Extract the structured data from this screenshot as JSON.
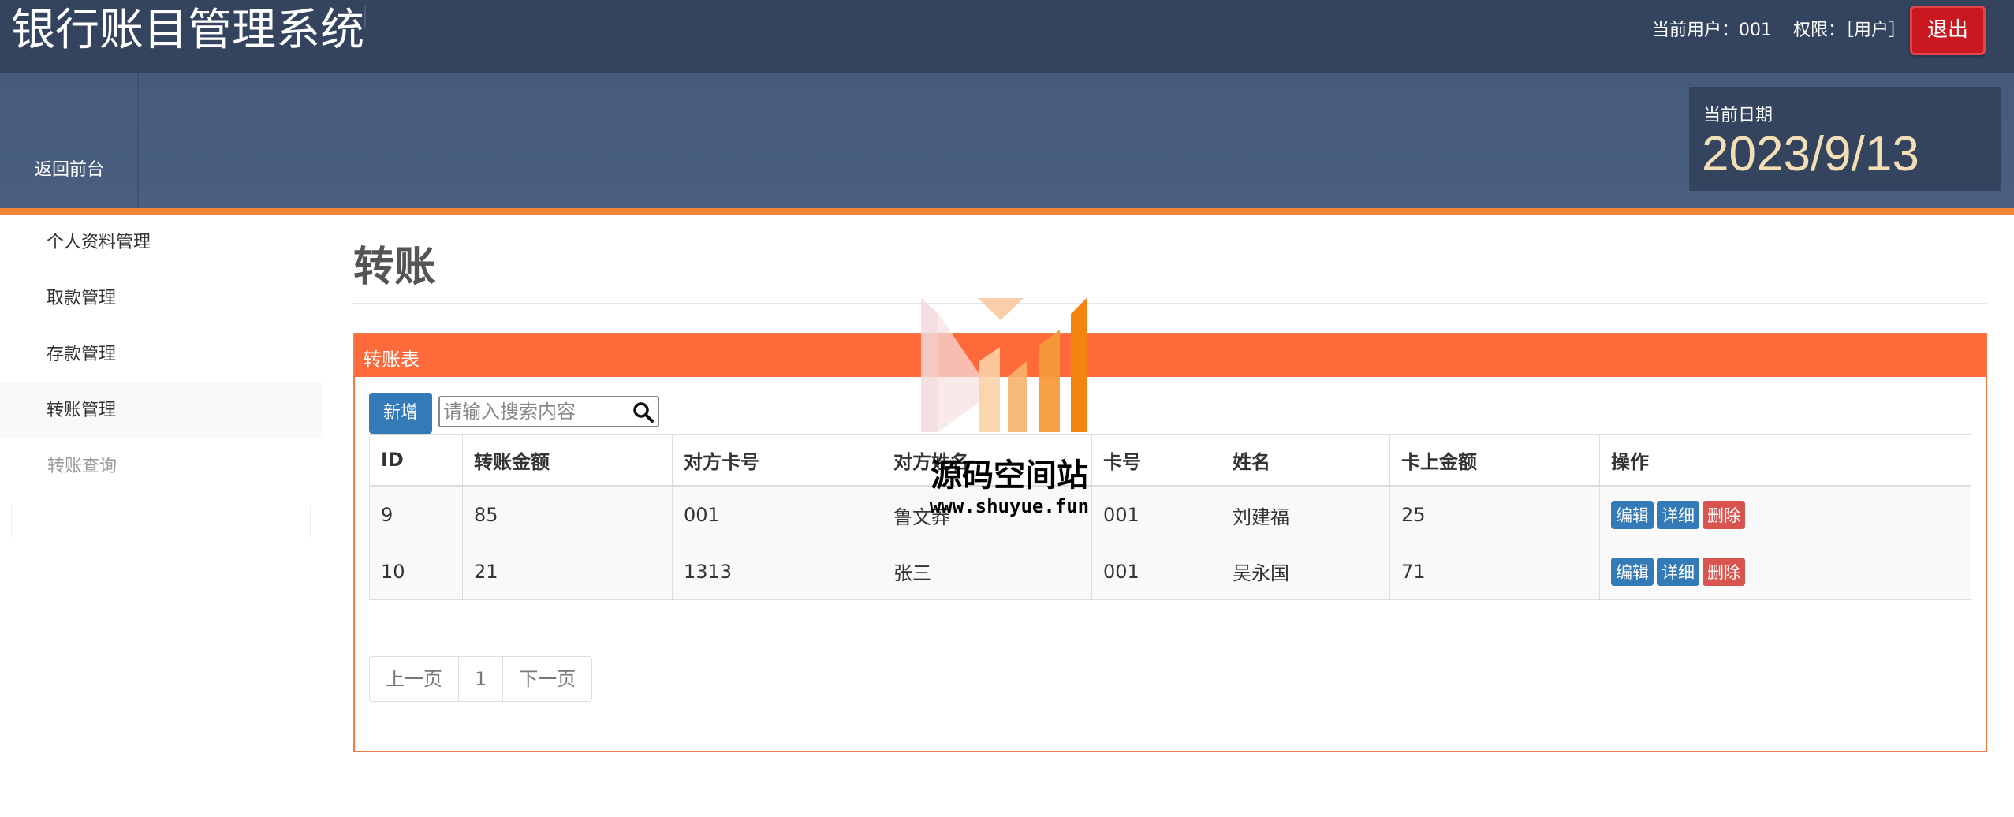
{
  "header": {
    "app_title": "银行账目管理系统",
    "current_user": "当前用户：001",
    "permission": "权限：［用户］",
    "logout_label": "退出"
  },
  "navbar": {
    "back_label": "返回前台",
    "date_label": "当前日期",
    "date_value": "2023/9/13"
  },
  "sidebar": {
    "items": [
      {
        "label": "个人资料管理"
      },
      {
        "label": "取款管理"
      },
      {
        "label": "存款管理"
      },
      {
        "label": "转账管理"
      }
    ],
    "sub_items": [
      {
        "label": "转账查询"
      }
    ]
  },
  "main": {
    "page_title": "转账",
    "panel_title": "转账表",
    "add_label": "新增",
    "search_placeholder": "请输入搜索内容",
    "columns": [
      "ID",
      "转账金额",
      "对方卡号",
      "对方姓名",
      "卡号",
      "姓名",
      "卡上金额",
      "操作"
    ],
    "rows": [
      {
        "id": "9",
        "amount": "85",
        "target_card": "001",
        "target_name": "鲁文莽",
        "card": "001",
        "name": "刘建福",
        "balance": "25"
      },
      {
        "id": "10",
        "amount": "21",
        "target_card": "1313",
        "target_name": "张三",
        "card": "001",
        "name": "吴永国",
        "balance": "71"
      }
    ],
    "row_actions": {
      "edit": "编辑",
      "detail": "详细",
      "delete": "删除"
    },
    "pager": {
      "prev": "上一页",
      "page": "1",
      "next": "下一页"
    }
  },
  "watermark": {
    "text": "源码空间站",
    "url": "www.shuyue.fun"
  },
  "colors": {
    "topbar": "#34445f",
    "accent_orange": "#ff6a3a",
    "primary_blue": "#337ab7",
    "danger_red": "#d9534f",
    "logout_red": "#c9181f"
  }
}
